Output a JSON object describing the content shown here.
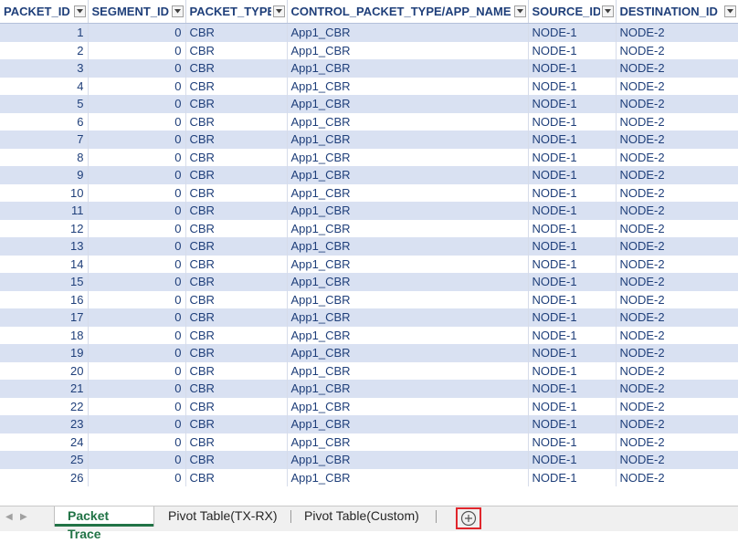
{
  "columns": [
    {
      "label": "PACKET_ID",
      "filter_icon": "filter-dropdown-icon"
    },
    {
      "label": "SEGMENT_ID",
      "filter_icon": "filter-dropdown-icon"
    },
    {
      "label": "PACKET_TYPE",
      "filter_icon": "filter-dropdown-icon"
    },
    {
      "label": "CONTROL_PACKET_TYPE/APP_NAME",
      "filter_icon": "filter-dropdown-icon"
    },
    {
      "label": "SOURCE_ID",
      "filter_icon": "filter-dropdown-icon"
    },
    {
      "label": "DESTINATION_ID",
      "filter_icon": "filter-dropdown-icon"
    }
  ],
  "rows": [
    [
      "1",
      "0",
      "CBR",
      "App1_CBR",
      "NODE-1",
      "NODE-2"
    ],
    [
      "2",
      "0",
      "CBR",
      "App1_CBR",
      "NODE-1",
      "NODE-2"
    ],
    [
      "3",
      "0",
      "CBR",
      "App1_CBR",
      "NODE-1",
      "NODE-2"
    ],
    [
      "4",
      "0",
      "CBR",
      "App1_CBR",
      "NODE-1",
      "NODE-2"
    ],
    [
      "5",
      "0",
      "CBR",
      "App1_CBR",
      "NODE-1",
      "NODE-2"
    ],
    [
      "6",
      "0",
      "CBR",
      "App1_CBR",
      "NODE-1",
      "NODE-2"
    ],
    [
      "7",
      "0",
      "CBR",
      "App1_CBR",
      "NODE-1",
      "NODE-2"
    ],
    [
      "8",
      "0",
      "CBR",
      "App1_CBR",
      "NODE-1",
      "NODE-2"
    ],
    [
      "9",
      "0",
      "CBR",
      "App1_CBR",
      "NODE-1",
      "NODE-2"
    ],
    [
      "10",
      "0",
      "CBR",
      "App1_CBR",
      "NODE-1",
      "NODE-2"
    ],
    [
      "11",
      "0",
      "CBR",
      "App1_CBR",
      "NODE-1",
      "NODE-2"
    ],
    [
      "12",
      "0",
      "CBR",
      "App1_CBR",
      "NODE-1",
      "NODE-2"
    ],
    [
      "13",
      "0",
      "CBR",
      "App1_CBR",
      "NODE-1",
      "NODE-2"
    ],
    [
      "14",
      "0",
      "CBR",
      "App1_CBR",
      "NODE-1",
      "NODE-2"
    ],
    [
      "15",
      "0",
      "CBR",
      "App1_CBR",
      "NODE-1",
      "NODE-2"
    ],
    [
      "16",
      "0",
      "CBR",
      "App1_CBR",
      "NODE-1",
      "NODE-2"
    ],
    [
      "17",
      "0",
      "CBR",
      "App1_CBR",
      "NODE-1",
      "NODE-2"
    ],
    [
      "18",
      "0",
      "CBR",
      "App1_CBR",
      "NODE-1",
      "NODE-2"
    ],
    [
      "19",
      "0",
      "CBR",
      "App1_CBR",
      "NODE-1",
      "NODE-2"
    ],
    [
      "20",
      "0",
      "CBR",
      "App1_CBR",
      "NODE-1",
      "NODE-2"
    ],
    [
      "21",
      "0",
      "CBR",
      "App1_CBR",
      "NODE-1",
      "NODE-2"
    ],
    [
      "22",
      "0",
      "CBR",
      "App1_CBR",
      "NODE-1",
      "NODE-2"
    ],
    [
      "23",
      "0",
      "CBR",
      "App1_CBR",
      "NODE-1",
      "NODE-2"
    ],
    [
      "24",
      "0",
      "CBR",
      "App1_CBR",
      "NODE-1",
      "NODE-2"
    ],
    [
      "25",
      "0",
      "CBR",
      "App1_CBR",
      "NODE-1",
      "NODE-2"
    ],
    [
      "26",
      "0",
      "CBR",
      "App1_CBR",
      "NODE-1",
      "NODE-2"
    ]
  ],
  "sheet_tabs": [
    {
      "label": "Packet Trace",
      "active": true
    },
    {
      "label": "Pivot Table(TX-RX)",
      "active": false
    },
    {
      "label": "Pivot Table(Custom)",
      "active": false
    }
  ],
  "add_sheet_icon": "plus-circle-icon",
  "colors": {
    "header_text": "#1f3f7a",
    "band_row": "#d9e1f2",
    "active_tab": "#217346",
    "highlight_box": "#e0262c"
  }
}
